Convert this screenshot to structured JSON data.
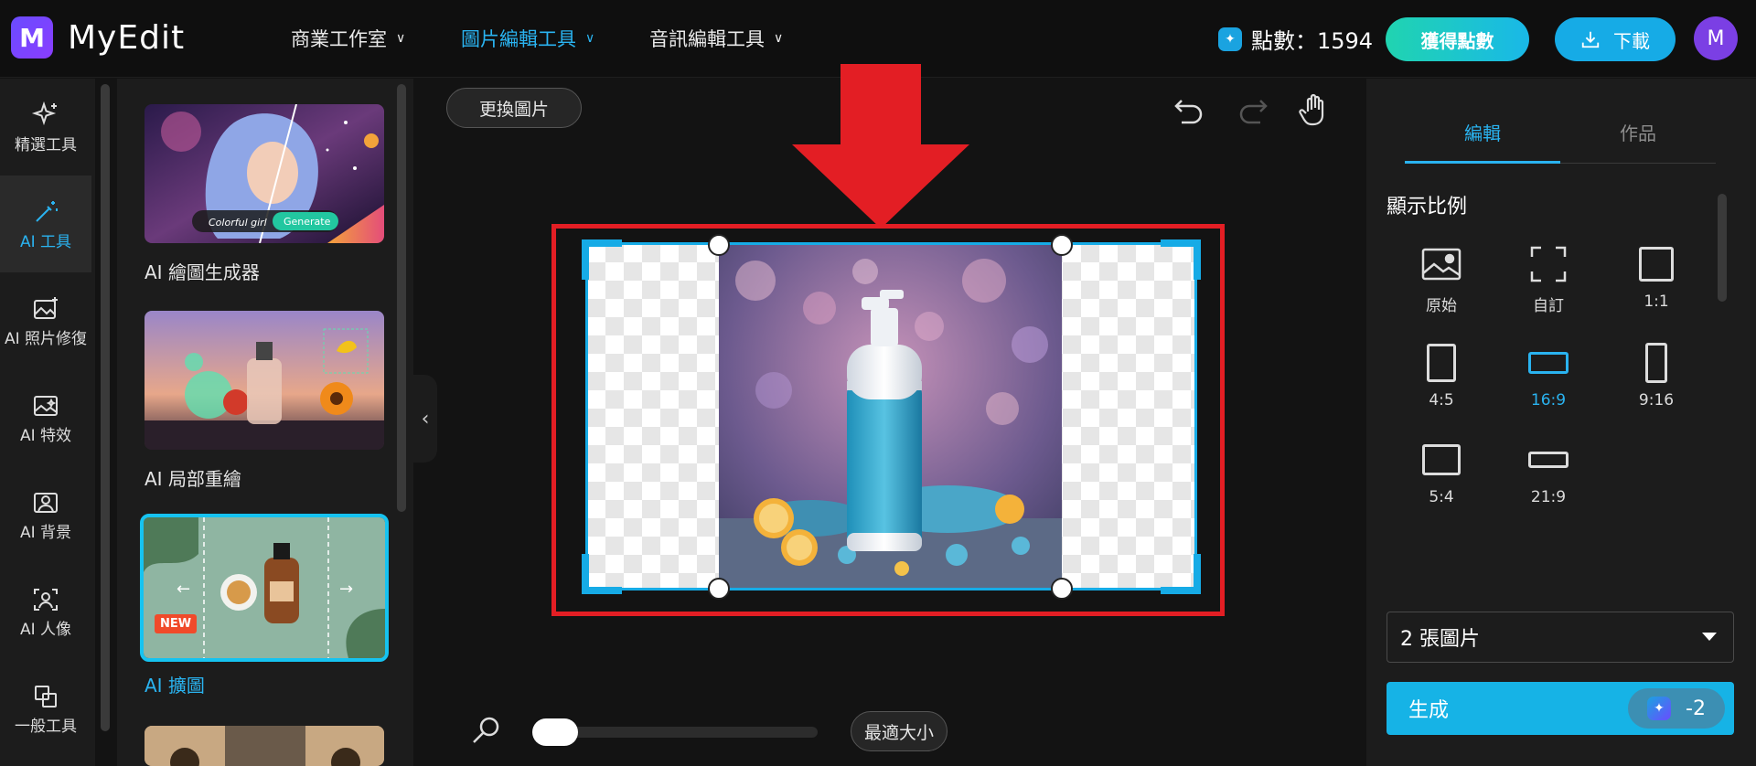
{
  "app": {
    "name": "MyEdit",
    "logo_letter": "M"
  },
  "nav": [
    {
      "label": "商業工作室",
      "active": false
    },
    {
      "label": "圖片編輯工具",
      "active": true
    },
    {
      "label": "音訊編輯工具",
      "active": false
    }
  ],
  "header": {
    "points_label": "點數：1594",
    "get_points": "獲得點數",
    "download": "下載",
    "avatar_letter": "M"
  },
  "rail": [
    {
      "label": "精選工具",
      "icon": "sparkle-icon"
    },
    {
      "label": "AI 工具",
      "icon": "magic-wand-icon",
      "active": true
    },
    {
      "label": "AI 照片修復",
      "icon": "photo-enhance-icon"
    },
    {
      "label": "AI 特效",
      "icon": "effect-icon"
    },
    {
      "label": "AI 背景",
      "icon": "background-icon"
    },
    {
      "label": "AI 人像",
      "icon": "portrait-icon"
    },
    {
      "label": "一般工具",
      "icon": "copy-icon"
    }
  ],
  "tools": [
    {
      "label": "AI 繪圖生成器",
      "thumb_text_1": "Colorful girl",
      "thumb_text_2": "Generate"
    },
    {
      "label": "AI 局部重繪"
    },
    {
      "label": "AI 擴圖",
      "badge": "NEW",
      "active": true
    }
  ],
  "canvas": {
    "replace_label": "更換圖片",
    "fit_label": "最適大小"
  },
  "right": {
    "tabs": [
      {
        "label": "編輯",
        "active": true
      },
      {
        "label": "作品",
        "active": false
      }
    ],
    "ratio_title": "顯示比例",
    "ratios": [
      {
        "label": "原始",
        "icon": "image-icon"
      },
      {
        "label": "自訂",
        "icon": "custom-crop-icon"
      },
      {
        "label": "1:1"
      },
      {
        "label": "4:5"
      },
      {
        "label": "16:9",
        "active": true
      },
      {
        "label": "9:16"
      },
      {
        "label": "5:4"
      },
      {
        "label": "21:9"
      }
    ],
    "count_select": "2 張圖片",
    "generate_label": "生成",
    "cost": "-2"
  },
  "colors": {
    "accent": "#2ab3f0",
    "annotation": "#e31e24",
    "bg": "#131313",
    "panel": "#1c1c1c"
  }
}
